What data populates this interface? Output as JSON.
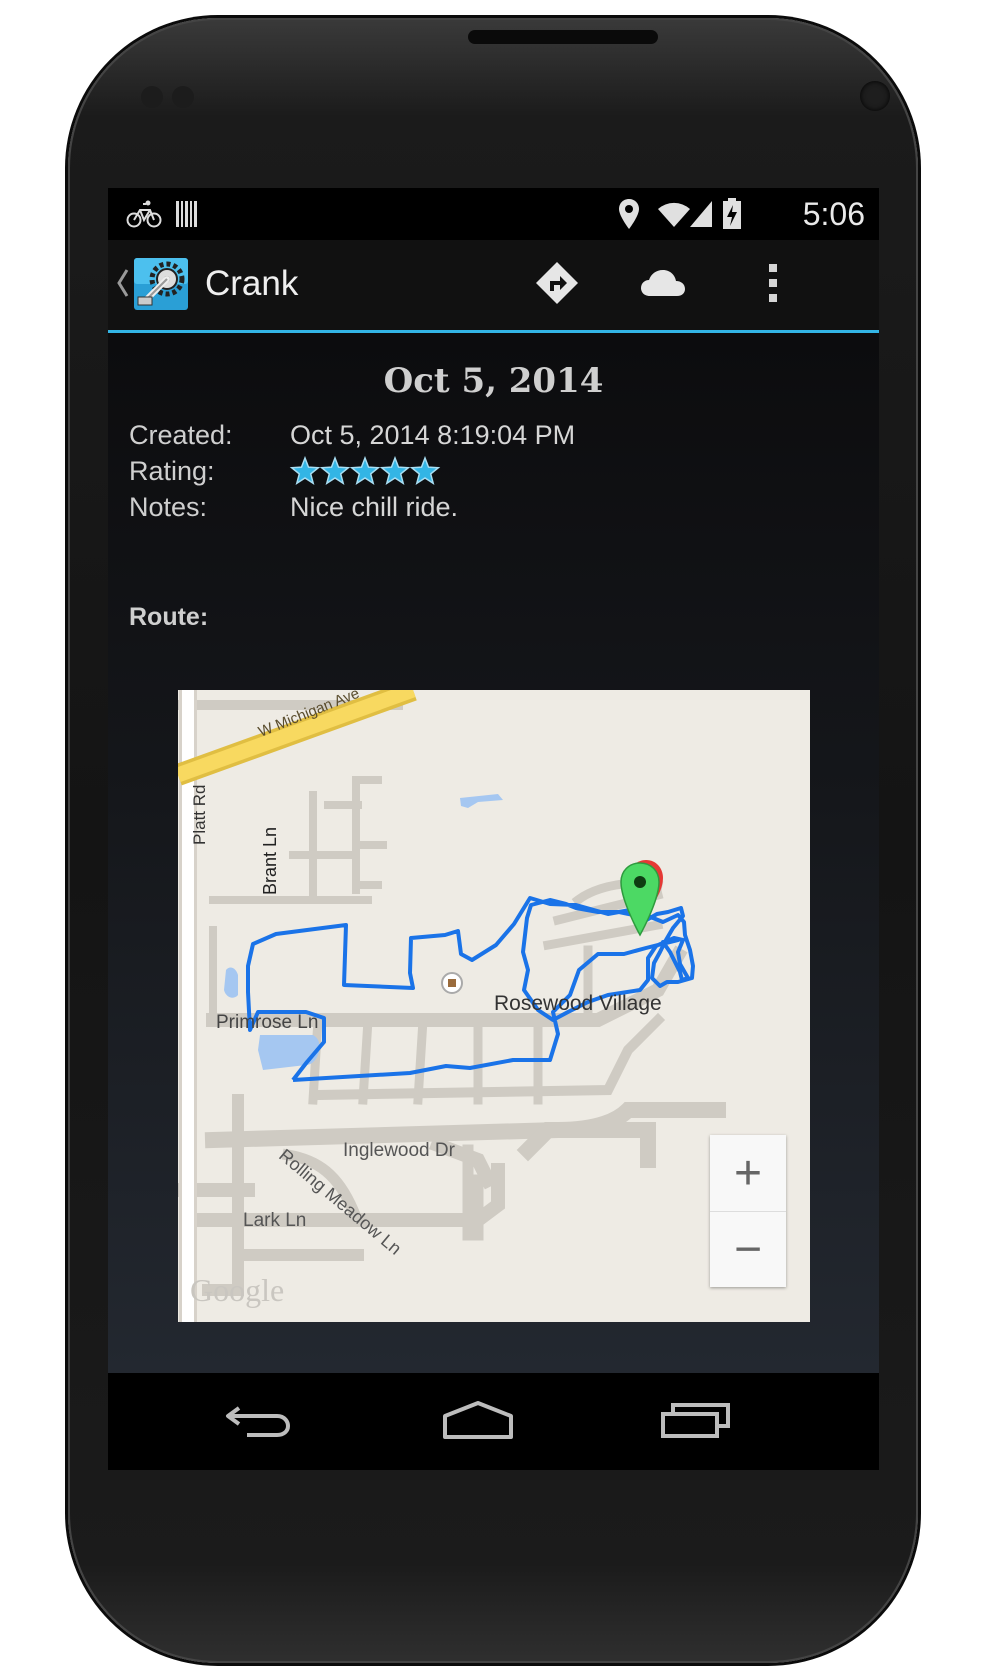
{
  "status_bar": {
    "time": "5:06",
    "icons": [
      "bicycle-icon",
      "barcode-icon",
      "location-pin-icon",
      "wifi-icon",
      "signal-icon",
      "battery-charging-icon"
    ]
  },
  "action_bar": {
    "title": "Crank",
    "up_icon": "chevron-left-icon",
    "app_icon": "crank-gear-icon",
    "actions": [
      "directions-icon",
      "cloud-icon",
      "overflow-menu-icon"
    ],
    "accent_color": "#33b5e5"
  },
  "ride": {
    "heading": "Oct 5, 2014",
    "created_label": "Created:",
    "created_value": "Oct 5, 2014 8:19:04 PM",
    "rating_label": "Rating:",
    "rating": 5,
    "rating_max": 5,
    "notes_label": "Notes:",
    "notes_value": "Nice chill ride.",
    "route_label": "Route:"
  },
  "map": {
    "streets": {
      "michigan": "W Michigan Ave",
      "platt": "Platt Rd",
      "brant": "Brant Ln",
      "primrose": "Primrose Ln",
      "inglewood": "Inglewood Dr",
      "rolling": "Rolling Meadow Ln",
      "lark": "Lark Ln"
    },
    "place": "Rosewood Village",
    "logo": "Google",
    "zoom_in": "+",
    "zoom_out": "−",
    "route_color": "#1a73e8",
    "start_marker_color": "#4cd964",
    "end_marker_color": "#e53935"
  },
  "nav_bar": {
    "buttons": [
      "back-icon",
      "home-icon",
      "recent-apps-icon"
    ]
  }
}
